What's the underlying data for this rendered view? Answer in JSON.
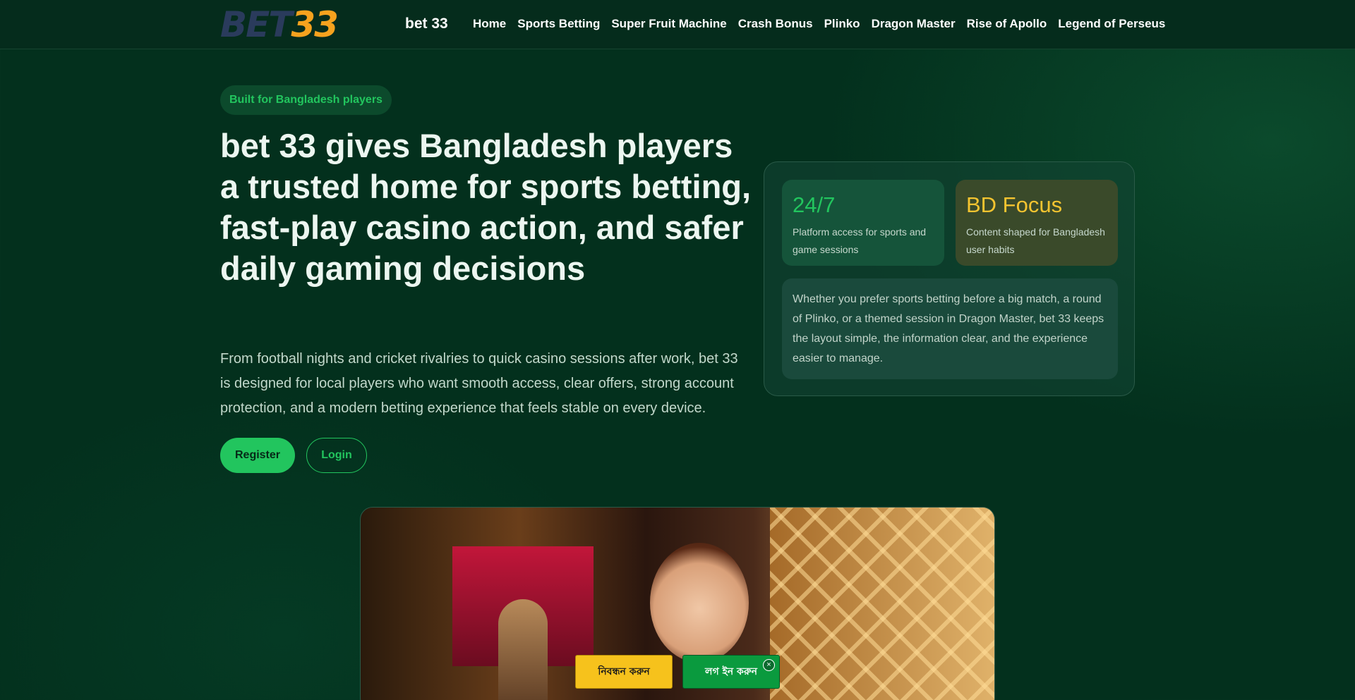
{
  "header": {
    "logo_text_main": "BET",
    "logo_text_num": "33",
    "brand": "bet 33",
    "nav": [
      "Home",
      "Sports Betting",
      "Super Fruit Machine",
      "Crash Bonus",
      "Plinko",
      "Dragon Master",
      "Rise of Apollo",
      "Legend of Perseus"
    ]
  },
  "hero": {
    "pill": "Built for Bangladesh players",
    "title": "bet 33 gives Bangladesh players a trusted home for sports betting, fast-play casino action, and safer daily gaming decisions",
    "description": "From football nights and cricket rivalries to quick casino sessions after work, bet 33 is designed for local players who want smooth access, clear offers, strong account protection, and a modern betting experience that feels stable on every device.",
    "register_label": "Register",
    "login_label": "Login"
  },
  "card": {
    "stat1": {
      "value": "24/7",
      "caption": "Platform access for sports and game sessions"
    },
    "stat2": {
      "value": "BD Focus",
      "caption": "Content shaped for Bangladesh user habits"
    },
    "text": "Whether you prefer sports betting before a big match, a round of Plinko, or a themed session in Dragon Master, bet 33 keeps the layout simple, the information clear, and the experience easier to manage."
  },
  "floating": {
    "register_label": "নিবন্ধন করুন",
    "login_label": "লগ ইন করুন",
    "close_glyph": "×"
  }
}
